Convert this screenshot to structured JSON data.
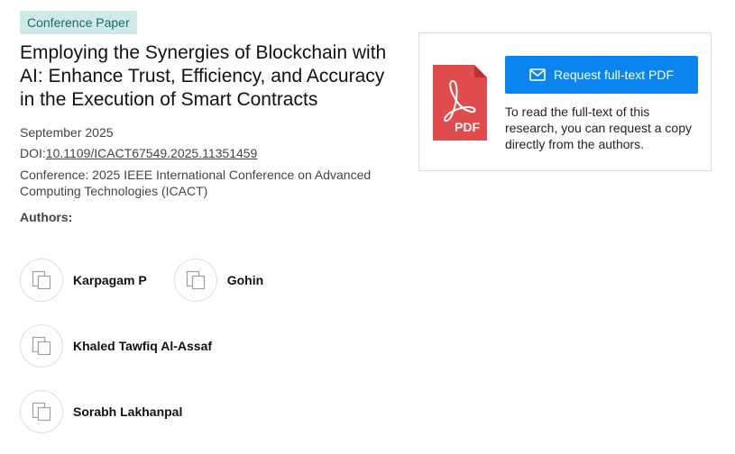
{
  "publication": {
    "badge": "Conference Paper",
    "title": "Employing the Synergies of Blockchain with AI: Enhance Trust, Efficiency, and Accuracy in the Execution of Smart Contracts",
    "date": "September 2025",
    "doi_label": "DOI:",
    "doi": "10.1109/ICACT67549.2025.11351459",
    "conference": "Conference: 2025 IEEE International Conference on Advanced Computing Technologies (ICACT)",
    "authors_label": "Authors:",
    "authors": [
      {
        "name": "Karpagam P"
      },
      {
        "name": "Gohin"
      },
      {
        "name": "Khaled Tawfiq Al-Assaf"
      },
      {
        "name": "Sorabh Lakhanpal"
      }
    ]
  },
  "fulltext_card": {
    "pdf_icon_label": "PDF",
    "button_label": "Request full-text PDF",
    "button_icon": "mail-icon",
    "description": "To read the full-text of this research, you can request a copy directly from the authors."
  },
  "colors": {
    "badge_bg": "#cfeae6",
    "badge_text": "#0f6f63",
    "button_bg": "#0a84ee",
    "pdf_red": "#e04b4b"
  }
}
